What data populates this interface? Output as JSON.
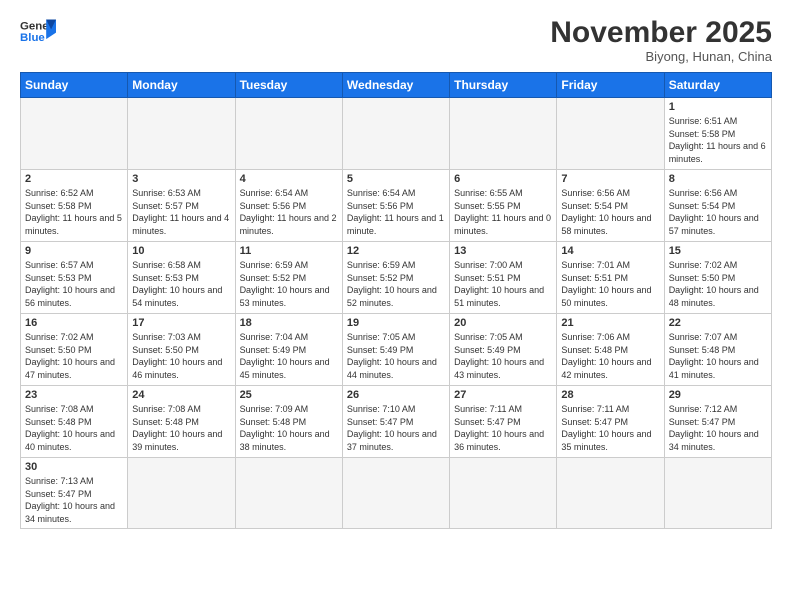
{
  "logo": {
    "text_general": "General",
    "text_blue": "Blue"
  },
  "header": {
    "month_title": "November 2025",
    "subtitle": "Biyong, Hunan, China"
  },
  "days_of_week": [
    "Sunday",
    "Monday",
    "Tuesday",
    "Wednesday",
    "Thursday",
    "Friday",
    "Saturday"
  ],
  "weeks": [
    [
      {
        "day": "",
        "info": ""
      },
      {
        "day": "",
        "info": ""
      },
      {
        "day": "",
        "info": ""
      },
      {
        "day": "",
        "info": ""
      },
      {
        "day": "",
        "info": ""
      },
      {
        "day": "",
        "info": ""
      },
      {
        "day": "1",
        "info": "Sunrise: 6:51 AM\nSunset: 5:58 PM\nDaylight: 11 hours and 6 minutes."
      }
    ],
    [
      {
        "day": "2",
        "info": "Sunrise: 6:52 AM\nSunset: 5:58 PM\nDaylight: 11 hours and 5 minutes."
      },
      {
        "day": "3",
        "info": "Sunrise: 6:53 AM\nSunset: 5:57 PM\nDaylight: 11 hours and 4 minutes."
      },
      {
        "day": "4",
        "info": "Sunrise: 6:54 AM\nSunset: 5:56 PM\nDaylight: 11 hours and 2 minutes."
      },
      {
        "day": "5",
        "info": "Sunrise: 6:54 AM\nSunset: 5:56 PM\nDaylight: 11 hours and 1 minute."
      },
      {
        "day": "6",
        "info": "Sunrise: 6:55 AM\nSunset: 5:55 PM\nDaylight: 11 hours and 0 minutes."
      },
      {
        "day": "7",
        "info": "Sunrise: 6:56 AM\nSunset: 5:54 PM\nDaylight: 10 hours and 58 minutes."
      },
      {
        "day": "8",
        "info": "Sunrise: 6:56 AM\nSunset: 5:54 PM\nDaylight: 10 hours and 57 minutes."
      }
    ],
    [
      {
        "day": "9",
        "info": "Sunrise: 6:57 AM\nSunset: 5:53 PM\nDaylight: 10 hours and 56 minutes."
      },
      {
        "day": "10",
        "info": "Sunrise: 6:58 AM\nSunset: 5:53 PM\nDaylight: 10 hours and 54 minutes."
      },
      {
        "day": "11",
        "info": "Sunrise: 6:59 AM\nSunset: 5:52 PM\nDaylight: 10 hours and 53 minutes."
      },
      {
        "day": "12",
        "info": "Sunrise: 6:59 AM\nSunset: 5:52 PM\nDaylight: 10 hours and 52 minutes."
      },
      {
        "day": "13",
        "info": "Sunrise: 7:00 AM\nSunset: 5:51 PM\nDaylight: 10 hours and 51 minutes."
      },
      {
        "day": "14",
        "info": "Sunrise: 7:01 AM\nSunset: 5:51 PM\nDaylight: 10 hours and 50 minutes."
      },
      {
        "day": "15",
        "info": "Sunrise: 7:02 AM\nSunset: 5:50 PM\nDaylight: 10 hours and 48 minutes."
      }
    ],
    [
      {
        "day": "16",
        "info": "Sunrise: 7:02 AM\nSunset: 5:50 PM\nDaylight: 10 hours and 47 minutes."
      },
      {
        "day": "17",
        "info": "Sunrise: 7:03 AM\nSunset: 5:50 PM\nDaylight: 10 hours and 46 minutes."
      },
      {
        "day": "18",
        "info": "Sunrise: 7:04 AM\nSunset: 5:49 PM\nDaylight: 10 hours and 45 minutes."
      },
      {
        "day": "19",
        "info": "Sunrise: 7:05 AM\nSunset: 5:49 PM\nDaylight: 10 hours and 44 minutes."
      },
      {
        "day": "20",
        "info": "Sunrise: 7:05 AM\nSunset: 5:49 PM\nDaylight: 10 hours and 43 minutes."
      },
      {
        "day": "21",
        "info": "Sunrise: 7:06 AM\nSunset: 5:48 PM\nDaylight: 10 hours and 42 minutes."
      },
      {
        "day": "22",
        "info": "Sunrise: 7:07 AM\nSunset: 5:48 PM\nDaylight: 10 hours and 41 minutes."
      }
    ],
    [
      {
        "day": "23",
        "info": "Sunrise: 7:08 AM\nSunset: 5:48 PM\nDaylight: 10 hours and 40 minutes."
      },
      {
        "day": "24",
        "info": "Sunrise: 7:08 AM\nSunset: 5:48 PM\nDaylight: 10 hours and 39 minutes."
      },
      {
        "day": "25",
        "info": "Sunrise: 7:09 AM\nSunset: 5:48 PM\nDaylight: 10 hours and 38 minutes."
      },
      {
        "day": "26",
        "info": "Sunrise: 7:10 AM\nSunset: 5:47 PM\nDaylight: 10 hours and 37 minutes."
      },
      {
        "day": "27",
        "info": "Sunrise: 7:11 AM\nSunset: 5:47 PM\nDaylight: 10 hours and 36 minutes."
      },
      {
        "day": "28",
        "info": "Sunrise: 7:11 AM\nSunset: 5:47 PM\nDaylight: 10 hours and 35 minutes."
      },
      {
        "day": "29",
        "info": "Sunrise: 7:12 AM\nSunset: 5:47 PM\nDaylight: 10 hours and 34 minutes."
      }
    ],
    [
      {
        "day": "30",
        "info": "Sunrise: 7:13 AM\nSunset: 5:47 PM\nDaylight: 10 hours and 34 minutes."
      },
      {
        "day": "",
        "info": ""
      },
      {
        "day": "",
        "info": ""
      },
      {
        "day": "",
        "info": ""
      },
      {
        "day": "",
        "info": ""
      },
      {
        "day": "",
        "info": ""
      },
      {
        "day": "",
        "info": ""
      }
    ]
  ]
}
